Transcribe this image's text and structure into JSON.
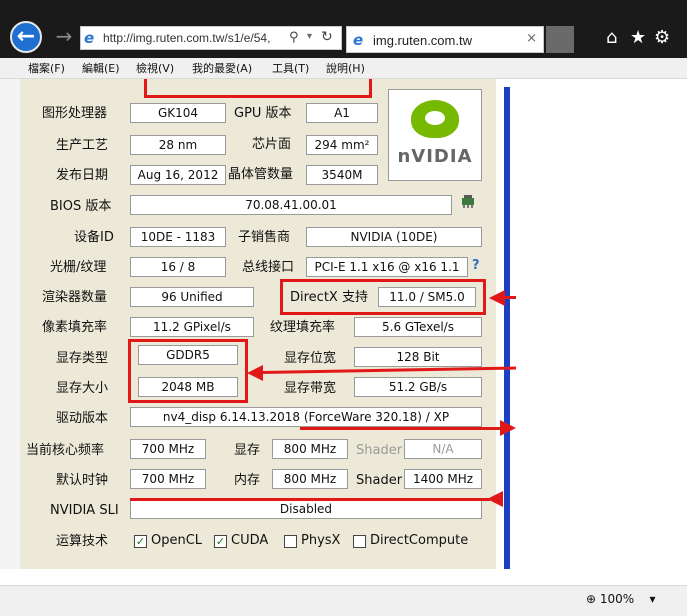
{
  "browser": {
    "url": "http://img.ruten.com.tw/s1/e/54,",
    "tab_title": "img.ruten.com.tw",
    "tab_close": "×",
    "zoom": "100%"
  },
  "menu": [
    "檔案(F)",
    "編輯(E)",
    "檢視(V)",
    "我的最愛(A)",
    "工具(T)",
    "說明(H)"
  ],
  "icons": {
    "back": "←",
    "forward": "→",
    "search": "⚲",
    "dropdown": "▾",
    "refresh": "↻",
    "home": "⌂",
    "star": "★",
    "gear": "⚙",
    "zoom": "⊕",
    "check": "✓"
  },
  "gpu": {
    "rows": {
      "gpu_core_label": "图形处理器",
      "gpu_core": "GK104",
      "revision_label": "GPU 版本",
      "revision": "A1",
      "process_label": "生产工艺",
      "process": "28 nm",
      "die_label": "芯片面",
      "die": "294 mm²",
      "release_label": "发布日期",
      "release": "Aug 16, 2012",
      "transistors_label": "晶体管数量",
      "transistors": "3540M",
      "bios_label": "BIOS 版本",
      "bios": "70.08.41.00.01",
      "device_label": "设备ID",
      "device": "10DE - 1183",
      "subvendor_label": "子销售商",
      "subvendor": "NVIDIA (10DE)",
      "rops_label": "光栅/纹理",
      "rops": "16 / 8",
      "bus_label": "总线接口",
      "bus": "PCI-E 1.1 x16 @ x16 1.1",
      "shaders_label": "渲染器数量",
      "shaders": "96 Unified",
      "directx_label": "DirectX 支持",
      "directx": "11.0 / SM5.0",
      "pixel_label": "像素填充率",
      "pixel": "11.2 GPixel/s",
      "texture_label": "纹理填充率",
      "texture": "5.6 GTexel/s",
      "memtype_label": "显存类型",
      "memtype": "GDDR5",
      "buswidth_label": "显存位宽",
      "buswidth": "128 Bit",
      "memsize_label": "显存大小",
      "memsize": "2048 MB",
      "bandwidth_label": "显存带宽",
      "bandwidth": "51.2 GB/s",
      "driver_label": "驱动版本",
      "driver": "nv4_disp 6.14.13.2018 (ForceWare 320.18) / XP",
      "clock_label": "当前核心频率",
      "clock": "700 MHz",
      "mem_label": "显存",
      "mem": "800 MHz",
      "shader_label": "Shader",
      "shader": "N/A",
      "default_label": "默认时钟",
      "default_clock": "700 MHz",
      "default_mem_label": "内存",
      "default_mem": "800 MHz",
      "default_shader_label": "Shader",
      "default_shader": "1400 MHz",
      "sli_label": "NVIDIA SLI",
      "sli": "Disabled",
      "compute_label": "运算技术"
    },
    "logo_text": "nVIDIA",
    "help": "?",
    "compute": [
      {
        "label": "OpenCL",
        "checked": true
      },
      {
        "label": "CUDA",
        "checked": true
      },
      {
        "label": "PhysX",
        "checked": false
      },
      {
        "label": "DirectCompute",
        "checked": false
      }
    ]
  }
}
